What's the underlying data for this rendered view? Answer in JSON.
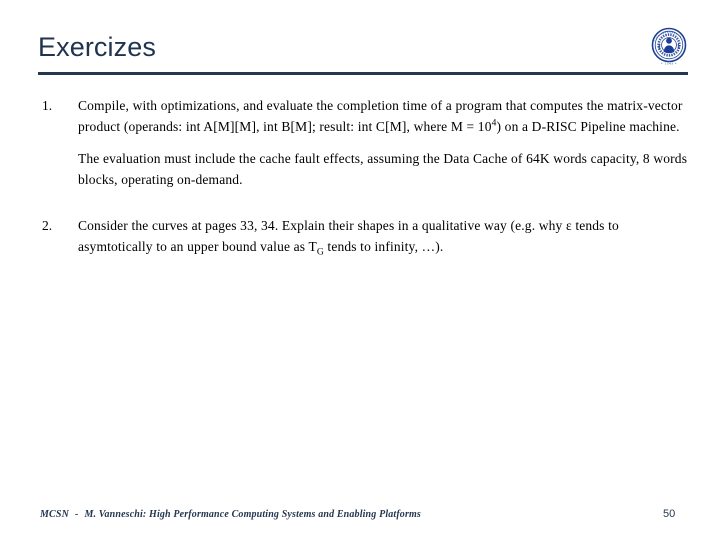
{
  "slide": {
    "title": "Exercizes",
    "accent_color": "#24374f",
    "background_color": "#ffffff",
    "logo": {
      "name": "university-of-pisa-seal",
      "rim_text_top": "IN SUPREMAE DIGNITATIS",
      "year": "1343",
      "color": "#1c3f94"
    }
  },
  "items": [
    {
      "number": "1.",
      "paragraphs": [
        {
          "runs": [
            {
              "t": "Compile, with optimizations, and evaluate the completion time of a program that computes the matrix-vector product (operands: int A[M][M], int B[M]; result: int C[M], where M = 10"
            },
            {
              "t": "4",
              "sup": true
            },
            {
              "t": ") on a D-RISC Pipeline machine."
            }
          ]
        },
        {
          "runs": [
            {
              "t": "The evaluation must include the cache fault effects, assuming the Data Cache of 64K words capacity, 8 words blocks, operating on-demand."
            }
          ]
        }
      ]
    },
    {
      "number": "2.",
      "paragraphs": [
        {
          "runs": [
            {
              "t": "Consider the curves at pages 33, 34. Explain their shapes in a qualitative way (e.g. why ε tends to asymtotically to an upper bound value as T"
            },
            {
              "t": "G",
              "sub": true
            },
            {
              "t": " tends to infinity, …)."
            }
          ]
        }
      ]
    }
  ],
  "footer": {
    "course": "MCSN",
    "separator": "-",
    "attribution": "M. Vanneschi: High Performance Computing Systems and Enabling Platforms",
    "page_number": "50"
  }
}
